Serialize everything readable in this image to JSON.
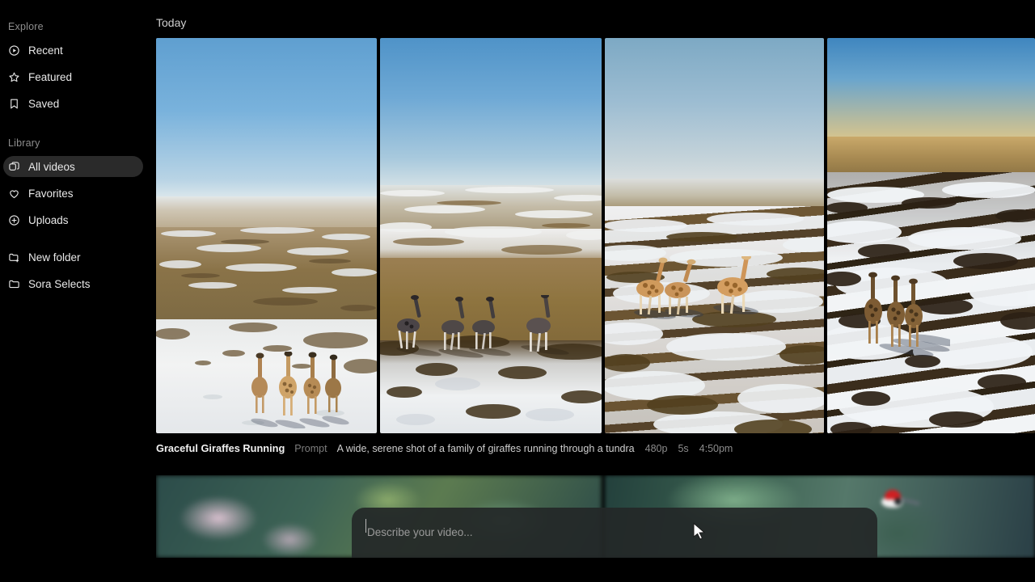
{
  "app": {
    "background": "#000000",
    "accent": "#2a2a2a"
  },
  "sidebar": {
    "sections": [
      {
        "label": "Explore",
        "items": [
          {
            "label": "Recent",
            "icon": "play-circle-icon",
            "active": false
          },
          {
            "label": "Featured",
            "icon": "star-icon",
            "active": false
          },
          {
            "label": "Saved",
            "icon": "bookmark-icon",
            "active": false
          }
        ]
      },
      {
        "label": "Library",
        "items": [
          {
            "label": "All videos",
            "icon": "stacked-squares-icon",
            "active": true
          },
          {
            "label": "Favorites",
            "icon": "heart-icon",
            "active": false
          },
          {
            "label": "Uploads",
            "icon": "plus-circle-icon",
            "active": false
          }
        ],
        "folders": [
          {
            "label": "New folder",
            "icon": "folder-plus-icon"
          },
          {
            "label": "Sora Selects",
            "icon": "folder-icon"
          }
        ]
      }
    ]
  },
  "main": {
    "day_header": "Today",
    "video": {
      "title": "Graceful Giraffes Running",
      "prompt_label": "Prompt",
      "prompt_text": "A wide, serene shot of a family of giraffes running through a tundra",
      "resolution": "480p",
      "duration": "5s",
      "time": "4:50pm",
      "clips": [
        {
          "name": "giraffes-walking-on-snow-wide"
        },
        {
          "name": "giraffes-running-on-tundra"
        },
        {
          "name": "giraffes-on-patchy-snow-plain"
        },
        {
          "name": "giraffes-on-snowfield-golden-horizon"
        }
      ]
    },
    "row2": {
      "clips": [
        {
          "name": "blurred-coral-reef-clip"
        },
        {
          "name": "red-crowned-bird-in-forest-clip"
        }
      ]
    }
  },
  "prompt_bar": {
    "placeholder": "Describe your video...",
    "value": ""
  }
}
